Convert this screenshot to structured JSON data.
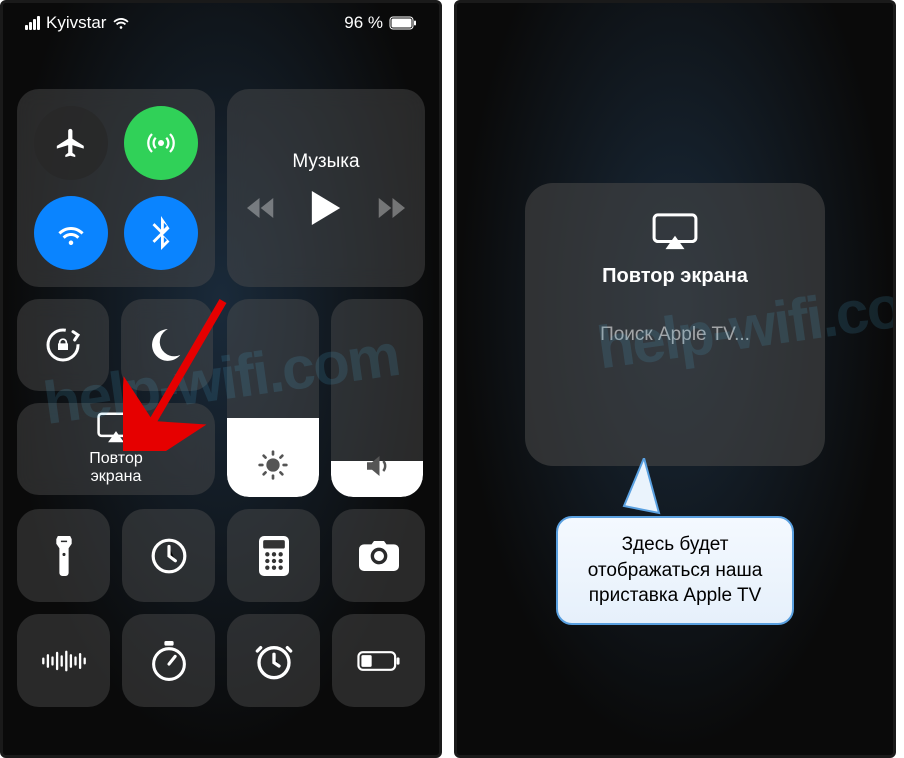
{
  "status": {
    "carrier": "Kyivstar",
    "battery_pct": "96 %"
  },
  "music": {
    "title": "Музыка"
  },
  "screen_mirror": {
    "line1": "Повтор",
    "line2": "экрана"
  },
  "right_popup": {
    "title": "Повтор экрана",
    "status": "Поиск Apple TV..."
  },
  "callout": {
    "text": "Здесь будет отображаться наша приставка Apple TV"
  },
  "watermark": "help-wifi.com"
}
